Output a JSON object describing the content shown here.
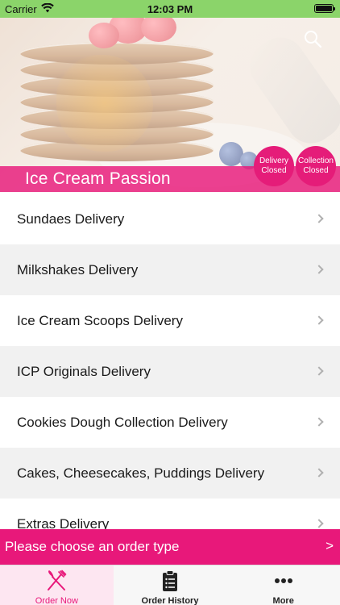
{
  "status_bar": {
    "carrier": "Carrier",
    "time": "12:03 PM",
    "icons": [
      "wifi-icon",
      "battery-icon"
    ]
  },
  "header": {
    "restaurant_name": "Ice Cream Passion",
    "search_icon": "search-icon",
    "delivery_badge": {
      "line1": "Delivery",
      "line2": "Closed"
    },
    "collection_badge": {
      "line1": "Collection",
      "line2": "Closed"
    }
  },
  "menu": {
    "items": [
      {
        "label": "Sundaes Delivery"
      },
      {
        "label": "Milkshakes Delivery"
      },
      {
        "label": "Ice Cream Scoops Delivery"
      },
      {
        "label": "ICP Originals Delivery"
      },
      {
        "label": "Cookies Dough Collection Delivery"
      },
      {
        "label": "Cakes, Cheesecakes, Puddings Delivery"
      },
      {
        "label": "Extras Delivery"
      }
    ]
  },
  "order_type_bar": {
    "label": "Please choose an order type",
    "arrow": ">"
  },
  "tabs": [
    {
      "label": "Order Now",
      "icon": "fork-knife-icon",
      "active": true
    },
    {
      "label": "Order History",
      "icon": "clipboard-icon",
      "active": false
    },
    {
      "label": "More",
      "icon": "more-dots-icon",
      "active": false
    }
  ],
  "colors": {
    "accent": "#e8187a",
    "status_bar": "#8bd46a",
    "row_alt": "#f1f1f1"
  }
}
